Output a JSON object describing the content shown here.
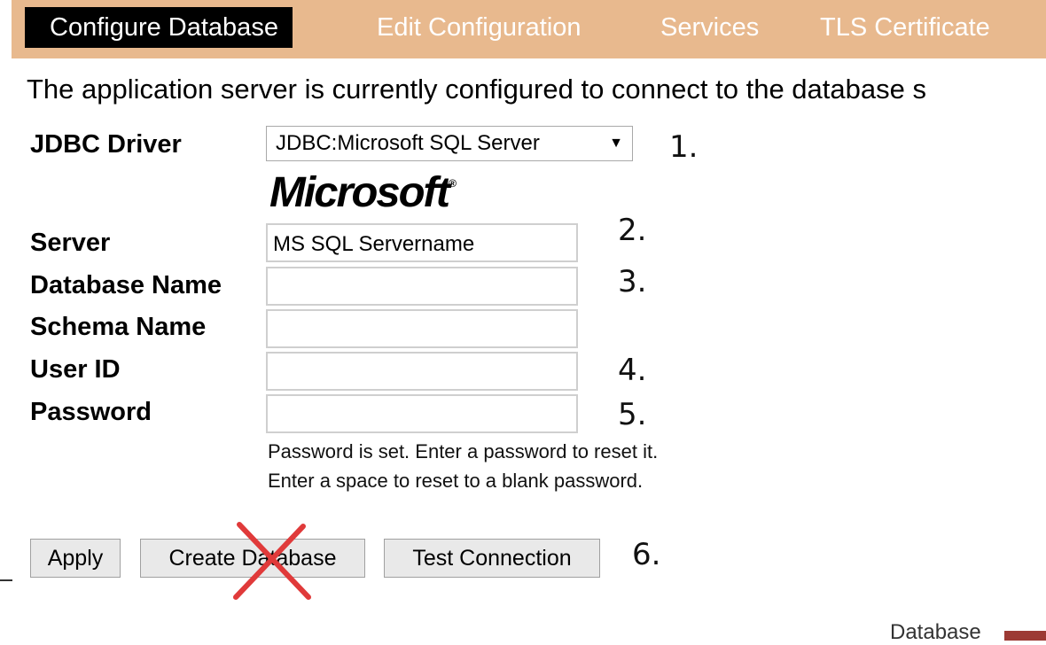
{
  "tabs": [
    {
      "label": "Configure Database",
      "active": true
    },
    {
      "label": "Edit Configuration",
      "active": false
    },
    {
      "label": "Services",
      "active": false
    },
    {
      "label": "TLS Certificate",
      "active": false
    }
  ],
  "intro_text": "The application server is currently configured to connect to the database s",
  "form": {
    "jdbc_driver_label": "JDBC Driver",
    "jdbc_driver_value": "JDBC:Microsoft SQL Server",
    "vendor_logo_text": "Microsoft",
    "server_label": "Server",
    "server_value": "MS SQL Servername",
    "database_name_label": "Database Name",
    "database_name_value": "",
    "schema_name_label": "Schema Name",
    "schema_name_value": "",
    "user_id_label": "User ID",
    "user_id_value": "",
    "password_label": "Password",
    "password_value": "",
    "password_hint_1": "Password is set. Enter a password to reset it.",
    "password_hint_2": "Enter a space to reset to a blank password."
  },
  "buttons": {
    "apply": "Apply",
    "create_database": "Create Database",
    "test_connection": "Test Connection"
  },
  "annotations": {
    "step_1": "1.",
    "step_2": "2.",
    "step_3": "3.",
    "step_4": "4.",
    "step_5": "5.",
    "step_6": "6.",
    "cross_color": "#e03a3a"
  },
  "footer": {
    "text": "Database",
    "accent_color": "#9c3a34"
  },
  "colors": {
    "tabbar_bg": "#e8b98e",
    "active_tab_bg": "#000000"
  }
}
